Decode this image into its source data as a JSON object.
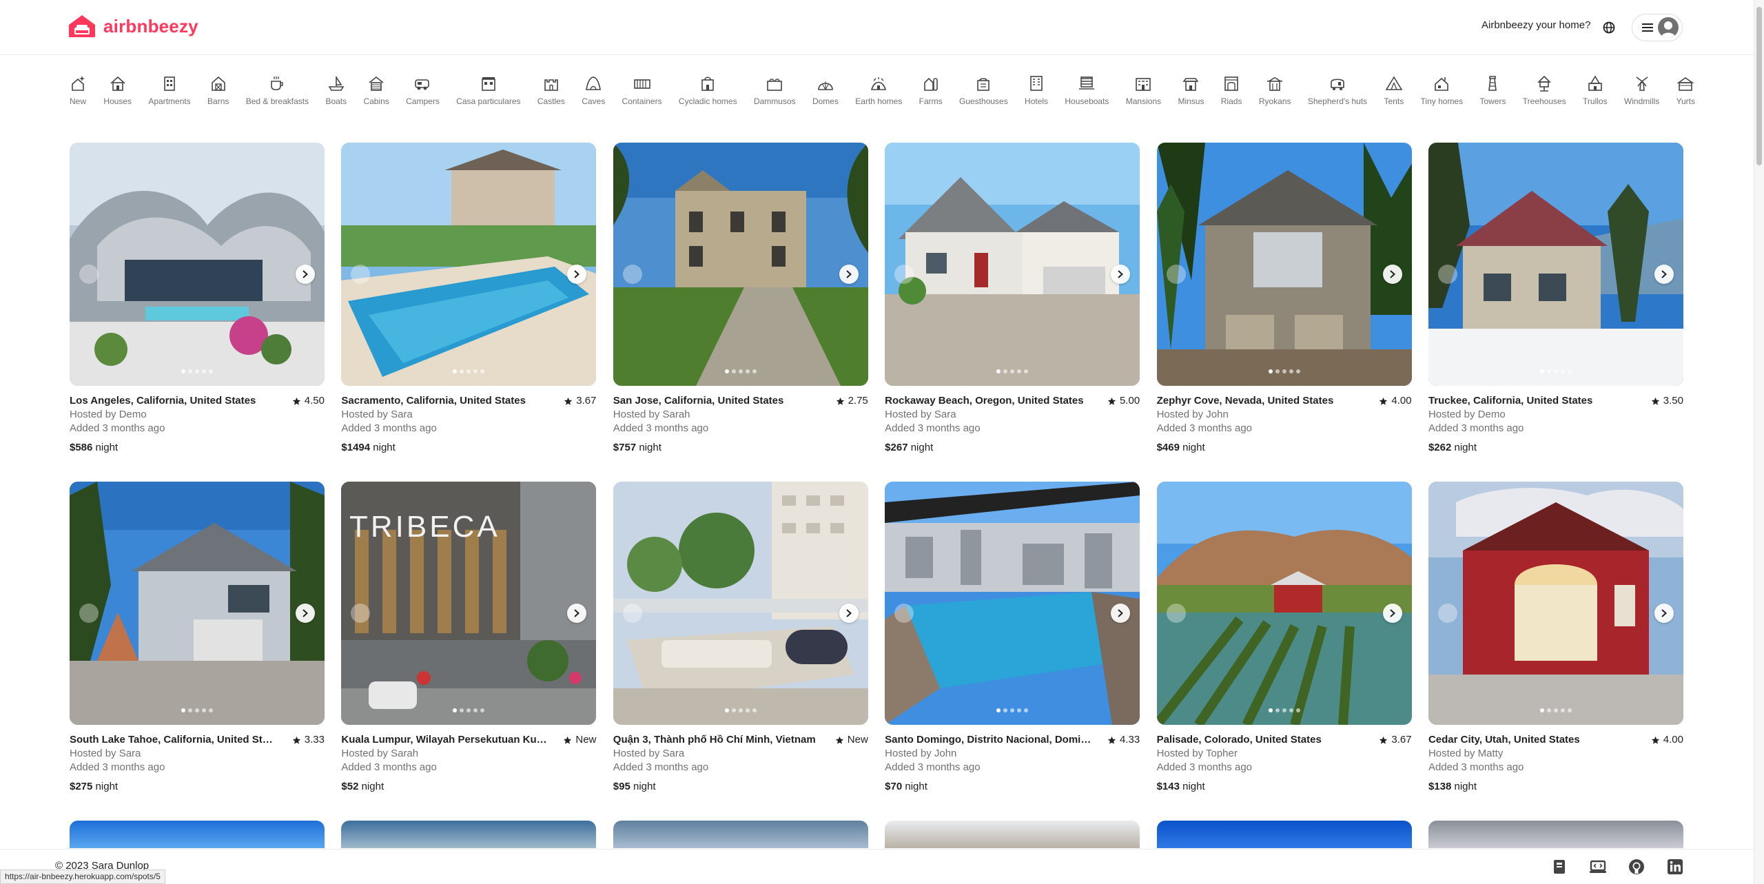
{
  "header": {
    "logo_text": "airbnbeezy",
    "host_link": "Airbnbeezy your home?",
    "brand_color": "#ff385c"
  },
  "categories": [
    {
      "label": "New",
      "icon": "sparkle-house-icon"
    },
    {
      "label": "Houses",
      "icon": "house-icon"
    },
    {
      "label": "Apartments",
      "icon": "apartment-icon"
    },
    {
      "label": "Barns",
      "icon": "barn-icon"
    },
    {
      "label": "Bed & breakfasts",
      "icon": "coffee-icon"
    },
    {
      "label": "Boats",
      "icon": "boat-icon"
    },
    {
      "label": "Cabins",
      "icon": "cabin-icon"
    },
    {
      "label": "Campers",
      "icon": "camper-icon"
    },
    {
      "label": "Casa particulares",
      "icon": "casa-icon"
    },
    {
      "label": "Castles",
      "icon": "castle-icon"
    },
    {
      "label": "Caves",
      "icon": "cave-icon"
    },
    {
      "label": "Containers",
      "icon": "container-icon"
    },
    {
      "label": "Cycladic homes",
      "icon": "cycladic-icon"
    },
    {
      "label": "Dammusos",
      "icon": "dammuso-icon"
    },
    {
      "label": "Domes",
      "icon": "dome-icon"
    },
    {
      "label": "Earth homes",
      "icon": "earth-home-icon"
    },
    {
      "label": "Farms",
      "icon": "farm-icon"
    },
    {
      "label": "Guesthouses",
      "icon": "guesthouse-icon"
    },
    {
      "label": "Hotels",
      "icon": "hotel-icon"
    },
    {
      "label": "Houseboats",
      "icon": "houseboat-icon"
    },
    {
      "label": "Mansions",
      "icon": "mansion-icon"
    },
    {
      "label": "Minsus",
      "icon": "minsu-icon"
    },
    {
      "label": "Riads",
      "icon": "riad-icon"
    },
    {
      "label": "Ryokans",
      "icon": "ryokan-icon"
    },
    {
      "label": "Shepherd's huts",
      "icon": "shepherd-hut-icon"
    },
    {
      "label": "Tents",
      "icon": "tent-icon"
    },
    {
      "label": "Tiny homes",
      "icon": "tiny-home-icon"
    },
    {
      "label": "Towers",
      "icon": "tower-icon"
    },
    {
      "label": "Treehouses",
      "icon": "treehouse-icon"
    },
    {
      "label": "Trullos",
      "icon": "trullo-icon"
    },
    {
      "label": "Windmills",
      "icon": "windmill-icon"
    },
    {
      "label": "Yurts",
      "icon": "yurt-icon"
    }
  ],
  "listings": [
    {
      "location": "Los Angeles, California, United States",
      "rating": "4.50",
      "host": "Hosted by Demo",
      "added": "Added 3 months ago",
      "price": "$586",
      "unit": "night"
    },
    {
      "location": "Sacramento, California, United States",
      "rating": "3.67",
      "host": "Hosted by Sara",
      "added": "Added 3 months ago",
      "price": "$1494",
      "unit": "night"
    },
    {
      "location": "San Jose, California, United States",
      "rating": "2.75",
      "host": "Hosted by Sarah",
      "added": "Added 3 months ago",
      "price": "$757",
      "unit": "night"
    },
    {
      "location": "Rockaway Beach, Oregon, United States",
      "rating": "5.00",
      "host": "Hosted by Sara",
      "added": "Added 3 months ago",
      "price": "$267",
      "unit": "night"
    },
    {
      "location": "Zephyr Cove, Nevada, United States",
      "rating": "4.00",
      "host": "Hosted by John",
      "added": "Added 3 months ago",
      "price": "$469",
      "unit": "night"
    },
    {
      "location": "Truckee, California, United States",
      "rating": "3.50",
      "host": "Hosted by Demo",
      "added": "Added 3 months ago",
      "price": "$262",
      "unit": "night"
    },
    {
      "location": "South Lake Tahoe, California, United States",
      "rating": "3.33",
      "host": "Hosted by Sara",
      "added": "Added 3 months ago",
      "price": "$275",
      "unit": "night"
    },
    {
      "location": "Kuala Lumpur, Wilayah Persekutuan Kuala...",
      "rating": "New",
      "host": "Hosted by Sarah",
      "added": "Added 3 months ago",
      "price": "$52",
      "unit": "night",
      "photo_text": "TRIBECA"
    },
    {
      "location": "Quận 3, Thành phố Hồ Chí Minh, Vietnam",
      "rating": "New",
      "host": "Hosted by Sara",
      "added": "Added 3 months ago",
      "price": "$95",
      "unit": "night"
    },
    {
      "location": "Santo Domingo, Distrito Nacional, Domini...",
      "rating": "4.33",
      "host": "Hosted by John",
      "added": "Added 3 months ago",
      "price": "$70",
      "unit": "night"
    },
    {
      "location": "Palisade, Colorado, United States",
      "rating": "3.67",
      "host": "Hosted by Topher",
      "added": "Added 3 months ago",
      "price": "$143",
      "unit": "night"
    },
    {
      "location": "Cedar City, Utah, United States",
      "rating": "4.00",
      "host": "Hosted by Matty",
      "added": "Added 3 months ago",
      "price": "$138",
      "unit": "night"
    }
  ],
  "footer": {
    "copyright": "© 2023 Sara Dunlop",
    "icons": [
      "portfolio-icon",
      "laptop-code-icon",
      "github-icon",
      "linkedin-icon"
    ]
  },
  "status_bar": {
    "url": "https://air-bnbeezy.herokuapp.com/spots/5"
  }
}
